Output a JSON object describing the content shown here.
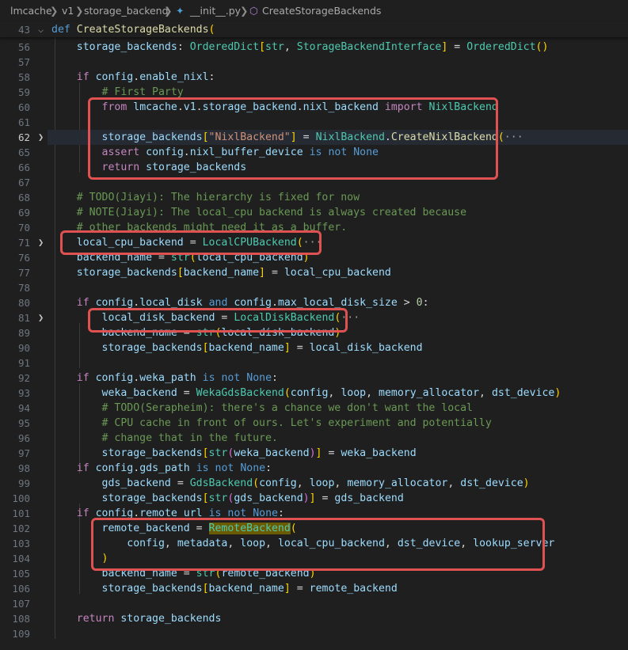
{
  "breadcrumb": {
    "items": [
      "lmcache",
      "v1",
      "storage_backend",
      "__init__.py",
      "CreateStorageBackends"
    ],
    "separator": ">"
  },
  "editor": {
    "sticky": {
      "num": "43",
      "text": "def CreateStorageBackends("
    },
    "lines": [
      {
        "num": "56",
        "text": "    storage_backends: OrderedDict[str, StorageBackendInterface] = OrderedDict()"
      },
      {
        "num": "57",
        "text": ""
      },
      {
        "num": "58",
        "text": "    if config.enable_nixl:"
      },
      {
        "num": "59",
        "text": "        # First Party"
      },
      {
        "num": "60",
        "text": "        from lmcache.v1.storage_backend.nixl_backend import NixlBackend"
      },
      {
        "num": "61",
        "text": ""
      },
      {
        "num": "62",
        "text": "        storage_backends[\"NixlBackend\"] = NixlBackend.CreateNixlBackend(···",
        "folded": true,
        "current": true
      },
      {
        "num": "65",
        "text": "        assert config.nixl_buffer_device is not None"
      },
      {
        "num": "66",
        "text": "        return storage_backends"
      },
      {
        "num": "67",
        "text": ""
      },
      {
        "num": "68",
        "text": "    # TODO(Jiayi): The hierarchy is fixed for now"
      },
      {
        "num": "69",
        "text": "    # NOTE(Jiayi): The local_cpu backend is always created because"
      },
      {
        "num": "70",
        "text": "    # other backends might need it as a buffer."
      },
      {
        "num": "71",
        "text": "    local_cpu_backend = LocalCPUBackend(···",
        "folded": true
      },
      {
        "num": "76",
        "text": "    backend_name = str(local_cpu_backend)"
      },
      {
        "num": "77",
        "text": "    storage_backends[backend_name] = local_cpu_backend"
      },
      {
        "num": "78",
        "text": ""
      },
      {
        "num": "80",
        "text": "    if config.local_disk and config.max_local_disk_size > 0:"
      },
      {
        "num": "81",
        "text": "        local_disk_backend = LocalDiskBackend(···",
        "folded": true
      },
      {
        "num": "89",
        "text": "        backend_name = str(local_disk_backend)"
      },
      {
        "num": "90",
        "text": "        storage_backends[backend_name] = local_disk_backend"
      },
      {
        "num": "91",
        "text": ""
      },
      {
        "num": "92",
        "text": "    if config.weka_path is not None:"
      },
      {
        "num": "93",
        "text": "        weka_backend = WekaGdsBackend(config, loop, memory_allocator, dst_device)"
      },
      {
        "num": "94",
        "text": "        # TODO(Serapheim): there's a chance we don't want the local"
      },
      {
        "num": "95",
        "text": "        # CPU cache in front of ours. Let's experiment and potentially"
      },
      {
        "num": "96",
        "text": "        # change that in the future."
      },
      {
        "num": "97",
        "text": "        storage_backends[str(weka_backend)] = weka_backend"
      },
      {
        "num": "98",
        "text": "    if config.gds_path is not None:"
      },
      {
        "num": "99",
        "text": "        gds_backend = GdsBackend(config, loop, memory_allocator, dst_device)"
      },
      {
        "num": "100",
        "text": "        storage_backends[str(gds_backend)] = gds_backend"
      },
      {
        "num": "101",
        "text": "    if config.remote_url is not None:"
      },
      {
        "num": "102",
        "text": "        remote_backend = RemoteBackend("
      },
      {
        "num": "103",
        "text": "            config, metadata, loop, local_cpu_backend, dst_device, lookup_server"
      },
      {
        "num": "104",
        "text": "        )"
      },
      {
        "num": "105",
        "text": "        backend_name = str(remote_backend)"
      },
      {
        "num": "106",
        "text": "        storage_backends[backend_name] = remote_backend"
      },
      {
        "num": "107",
        "text": ""
      },
      {
        "num": "108",
        "text": "    return storage_backends"
      },
      {
        "num": "109",
        "text": ""
      }
    ]
  },
  "colors": {
    "background": "#1f1f1f",
    "highlight_box": "#e05252",
    "keyword": "#569cd6",
    "control": "#c586c0",
    "function": "#dcdcaa",
    "class": "#4ec9b0",
    "string": "#ce9178",
    "comment": "#6a9955",
    "variable": "#9cdcfe"
  },
  "icons": [
    "chevron-right-icon",
    "python-file-icon",
    "symbol-method-icon",
    "fold-chevron-icon"
  ]
}
